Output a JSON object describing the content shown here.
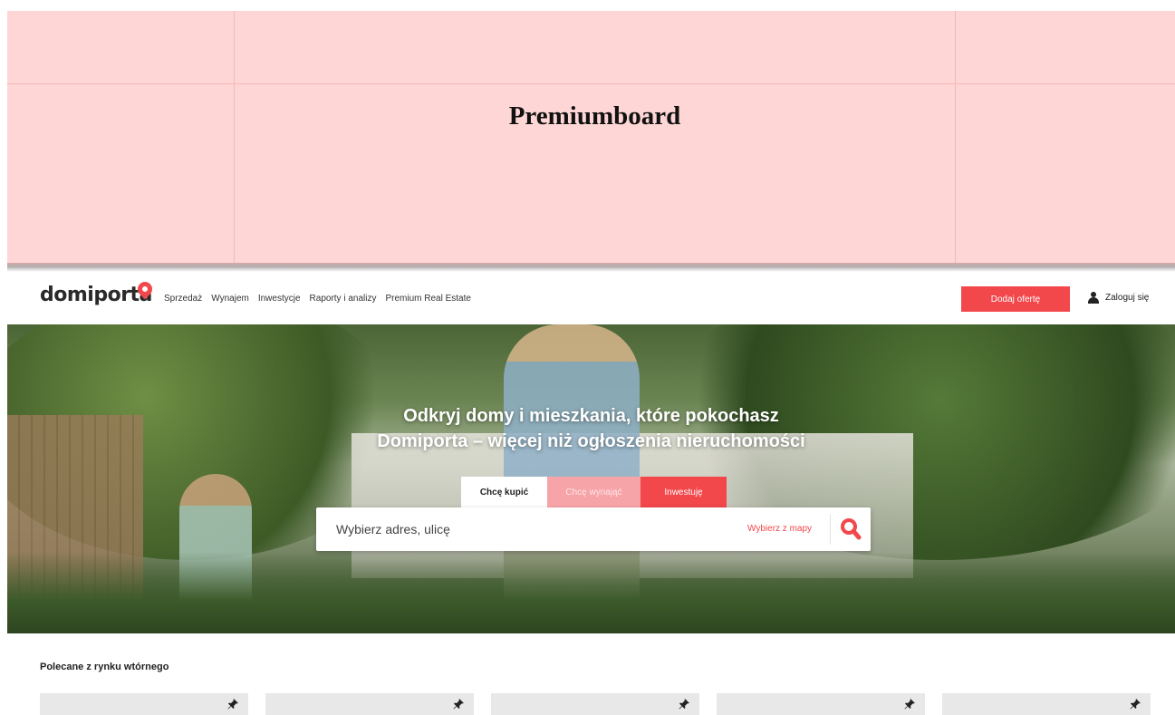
{
  "banner": {
    "title": "Premiumboard"
  },
  "header": {
    "logo": "domiporta",
    "nav": [
      "Sprzedaż",
      "Wynajem",
      "Inwestycje",
      "Raporty i analizy",
      "Premium Real Estate"
    ],
    "add_offer_label": "Dodaj ofertę",
    "login_label": "Zaloguj się",
    "accent_color": "#f2474b"
  },
  "hero": {
    "headline_1": "Odkryj domy i mieszkania, które pokochasz",
    "headline_2": "Domiporta – więcej niż ogłoszenia nieruchomości",
    "tabs": [
      "Chcę kupić",
      "Chcę wynająć",
      "Inwestuję"
    ],
    "active_tab": "Chcę kupić",
    "search": {
      "placeholder": "Wybierz adres, ulicę",
      "map_link": "Wybierz z mapy"
    }
  },
  "recommended": {
    "title": "Polecane z rynku wtórnego",
    "card_count_visible": 5
  }
}
